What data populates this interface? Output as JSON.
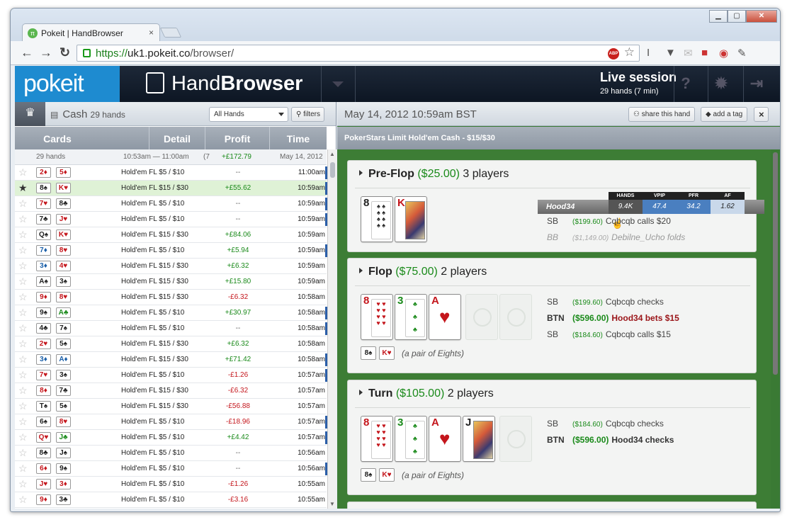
{
  "browser": {
    "tab_title": "Pokeit | HandBrowser",
    "tab_close": "×",
    "url_secure": "https://",
    "url_host": "uk1.pokeit.co",
    "url_path": "/browser/",
    "abp": "ABP"
  },
  "app": {
    "logo": "pokeit",
    "title_light": "Hand",
    "title_bold": "Browser",
    "session_title": "Live session",
    "session_sub": "29 hands (7 min)"
  },
  "left": {
    "cash_label": "Cash",
    "cash_count": "29 hands",
    "hands_select": "All Hands",
    "filters_label": "filters",
    "columns": [
      "Cards",
      "Detail",
      "Profit",
      "Time"
    ],
    "summary": {
      "hands": "29 hands",
      "range": "10:53am — 11:00am",
      "paren": "(7",
      "profit": "+£172.79",
      "date": "May 14, 2012"
    },
    "rows": [
      {
        "c1": "2♦",
        "c1c": "r",
        "c2": "5♦",
        "c2c": "r",
        "game": "Hold'em FL $5 / $10",
        "profit": "--",
        "pc": "neu",
        "time": "11:00am",
        "star": "☆",
        "mark": true
      },
      {
        "c1": "8♠",
        "c1c": "b",
        "c2": "K♥",
        "c2c": "r",
        "game": "Hold'em FL $15 / $30",
        "profit": "+£55.62",
        "pc": "pos",
        "time": "10:59am",
        "star": "★",
        "sel": true,
        "mark": true
      },
      {
        "c1": "7♥",
        "c1c": "r",
        "c2": "8♣",
        "c2c": "b",
        "game": "Hold'em FL $5 / $10",
        "profit": "--",
        "pc": "neu",
        "time": "10:59am",
        "star": "☆",
        "mark": true
      },
      {
        "c1": "7♣",
        "c1c": "b",
        "c2": "J♥",
        "c2c": "r",
        "game": "Hold'em FL $5 / $10",
        "profit": "--",
        "pc": "neu",
        "time": "10:59am",
        "star": "☆",
        "mark": true
      },
      {
        "c1": "Q♠",
        "c1c": "b",
        "c2": "K♥",
        "c2c": "r",
        "game": "Hold'em FL $15 / $30",
        "profit": "+£84.06",
        "pc": "pos",
        "time": "10:59am",
        "star": "☆",
        "mark": false
      },
      {
        "c1": "7♦",
        "c1c": "u",
        "c2": "8♥",
        "c2c": "r",
        "game": "Hold'em FL $5 / $10",
        "profit": "+£5.94",
        "pc": "pos",
        "time": "10:59am",
        "star": "☆",
        "mark": true
      },
      {
        "c1": "3♦",
        "c1c": "u",
        "c2": "4♥",
        "c2c": "r",
        "game": "Hold'em FL $15 / $30",
        "profit": "+£6.32",
        "pc": "pos",
        "time": "10:59am",
        "star": "☆",
        "mark": false
      },
      {
        "c1": "A♠",
        "c1c": "b",
        "c2": "3♠",
        "c2c": "b",
        "game": "Hold'em FL $15 / $30",
        "profit": "+£15.80",
        "pc": "pos",
        "time": "10:59am",
        "star": "☆",
        "mark": false
      },
      {
        "c1": "9♦",
        "c1c": "r",
        "c2": "8♥",
        "c2c": "r",
        "game": "Hold'em FL $15 / $30",
        "profit": "-£6.32",
        "pc": "neg",
        "time": "10:58am",
        "star": "☆",
        "mark": false
      },
      {
        "c1": "9♠",
        "c1c": "b",
        "c2": "A♣",
        "c2c": "g",
        "game": "Hold'em FL $5 / $10",
        "profit": "+£30.97",
        "pc": "pos",
        "time": "10:58am",
        "star": "☆",
        "mark": true
      },
      {
        "c1": "4♣",
        "c1c": "b",
        "c2": "7♠",
        "c2c": "b",
        "game": "Hold'em FL $5 / $10",
        "profit": "--",
        "pc": "neu",
        "time": "10:58am",
        "star": "☆",
        "mark": true
      },
      {
        "c1": "2♥",
        "c1c": "r",
        "c2": "5♠",
        "c2c": "b",
        "game": "Hold'em FL $15 / $30",
        "profit": "+£6.32",
        "pc": "pos",
        "time": "10:58am",
        "star": "☆",
        "mark": false
      },
      {
        "c1": "3♦",
        "c1c": "u",
        "c2": "A♦",
        "c2c": "u",
        "game": "Hold'em FL $15 / $30",
        "profit": "+£71.42",
        "pc": "pos",
        "time": "10:58am",
        "star": "☆",
        "mark": true
      },
      {
        "c1": "7♥",
        "c1c": "r",
        "c2": "3♠",
        "c2c": "b",
        "game": "Hold'em FL $5 / $10",
        "profit": "-£1.26",
        "pc": "neg",
        "time": "10:57am",
        "star": "☆",
        "mark": true
      },
      {
        "c1": "8♦",
        "c1c": "r",
        "c2": "7♣",
        "c2c": "b",
        "game": "Hold'em FL $15 / $30",
        "profit": "-£6.32",
        "pc": "neg",
        "time": "10:57am",
        "star": "☆",
        "mark": false
      },
      {
        "c1": "T♠",
        "c1c": "b",
        "c2": "5♠",
        "c2c": "b",
        "game": "Hold'em FL $15 / $30",
        "profit": "-£56.88",
        "pc": "neg",
        "time": "10:57am",
        "star": "☆",
        "mark": false
      },
      {
        "c1": "6♠",
        "c1c": "b",
        "c2": "8♥",
        "c2c": "r",
        "game": "Hold'em FL $5 / $10",
        "profit": "-£18.96",
        "pc": "neg",
        "time": "10:57am",
        "star": "☆",
        "mark": true
      },
      {
        "c1": "Q♥",
        "c1c": "r",
        "c2": "J♣",
        "c2c": "g",
        "game": "Hold'em FL $5 / $10",
        "profit": "+£4.42",
        "pc": "pos",
        "time": "10:57am",
        "star": "☆",
        "mark": true
      },
      {
        "c1": "8♣",
        "c1c": "b",
        "c2": "J♠",
        "c2c": "b",
        "game": "Hold'em FL $5 / $10",
        "profit": "--",
        "pc": "neu",
        "time": "10:56am",
        "star": "☆",
        "mark": false
      },
      {
        "c1": "6♦",
        "c1c": "r",
        "c2": "9♠",
        "c2c": "b",
        "game": "Hold'em FL $5 / $10",
        "profit": "--",
        "pc": "neu",
        "time": "10:56am",
        "star": "☆",
        "mark": true
      },
      {
        "c1": "J♥",
        "c1c": "r",
        "c2": "3♦",
        "c2c": "r",
        "game": "Hold'em FL $5 / $10",
        "profit": "-£1.26",
        "pc": "neg",
        "time": "10:55am",
        "star": "☆",
        "mark": false
      },
      {
        "c1": "9♦",
        "c1c": "r",
        "c2": "3♣",
        "c2c": "b",
        "game": "Hold'em FL $5 / $10",
        "profit": "-£3.16",
        "pc": "neg",
        "time": "10:55am",
        "star": "☆",
        "mark": false
      }
    ]
  },
  "right": {
    "date": "May 14, 2012  10:59am BST",
    "share": "share this hand",
    "tag": "add a tag",
    "close": "×",
    "subheader": "PokerStars  Limit Hold'em Cash - $15/$30",
    "preflop": {
      "street": "Pre-Flop",
      "amount": "($25.00)",
      "players": "3 players",
      "hud": {
        "name": "Hood34",
        "labels": [
          "HANDS",
          "VPIP",
          "PFR",
          "AF"
        ],
        "values": [
          "9.4K",
          "47.4",
          "34.2",
          "1.62"
        ]
      },
      "actions": [
        {
          "pos": "SB",
          "stack": "($199.60)",
          "text": "Cqbcqb calls $20"
        },
        {
          "pos": "BB",
          "stack": "($1,149.00)",
          "text": "Debilne_Ucho folds"
        }
      ]
    },
    "flop": {
      "street": "Flop",
      "amount": "($75.00)",
      "players": "2 players",
      "actions": [
        {
          "pos": "SB",
          "stack": "($199.60)",
          "text": "Cqbcqb checks"
        },
        {
          "pos": "BTN",
          "stack": "($596.00)",
          "text": "Hood34 bets $15"
        },
        {
          "pos": "SB",
          "stack": "($184.60)",
          "text": "Cqbcqb calls $15"
        }
      ],
      "desc": "(a pair of Eights)"
    },
    "turn": {
      "street": "Turn",
      "amount": "($105.00)",
      "players": "2 players",
      "actions": [
        {
          "pos": "SB",
          "stack": "($184.60)",
          "text": "Cqbcqb checks"
        },
        {
          "pos": "BTN",
          "stack": "($596.00)",
          "text": "Hood34 checks"
        }
      ],
      "desc": "(a pair of Eights)"
    },
    "cards": {
      "eight": "8",
      "king": "K",
      "three": "3",
      "ace": "A",
      "jack": "J",
      "hero1": "8♠",
      "hero2": "K♥"
    }
  }
}
